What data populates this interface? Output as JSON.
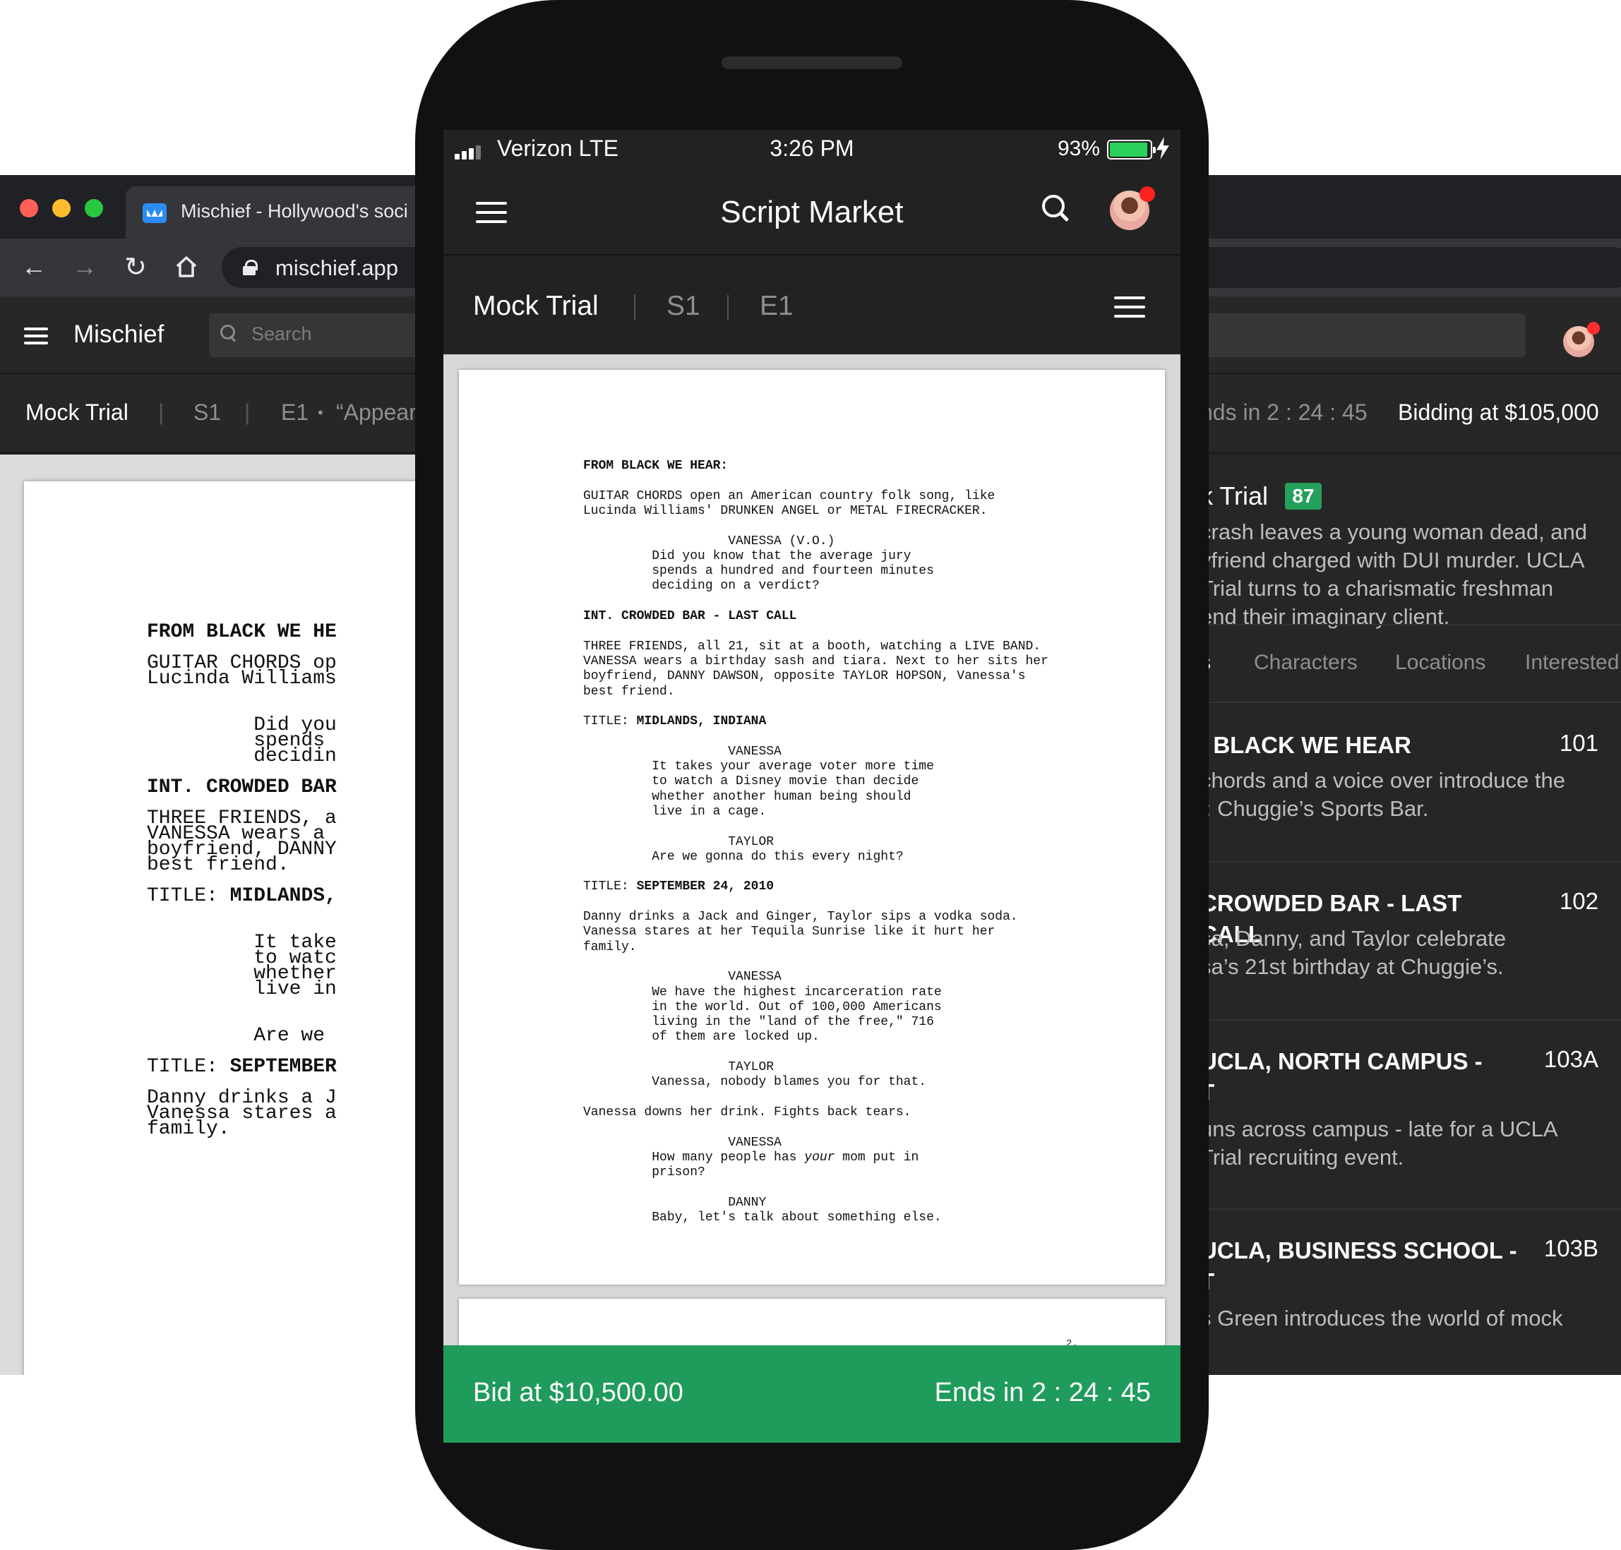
{
  "browser": {
    "tab_title": "Mischief - Hollywood's soci",
    "url": "mischief.app",
    "app_name": "Mischief",
    "search_placeholder": "Search",
    "breadcrumb": {
      "project": "Mock Trial",
      "sep1": "|",
      "season": "S1",
      "sep2": "|",
      "episode": "E1",
      "bullet": "•",
      "episode_title": "“Appear"
    },
    "ends_in": "nds in 2 : 24 : 45",
    "bidding": "Bidding at $105,000",
    "script_lines": [
      {
        "text": "FROM BLACK WE HE",
        "bold": true
      },
      {
        "text": "GUITAR CHORDS op"
      },
      {
        "text": "Lucinda Williams"
      },
      {
        "text": "         Did you"
      },
      {
        "text": "         spends"
      },
      {
        "text": "         decidin"
      },
      {
        "text": "INT. CROWDED BAR",
        "bold": true
      },
      {
        "text": "THREE FRIENDS, a"
      },
      {
        "text": "VANESSA wears a"
      },
      {
        "text": "boyfriend, DANNY"
      },
      {
        "text": "best friend."
      },
      {
        "text": "TITLE: MIDLANDS,"
      },
      {
        "text": "         It take"
      },
      {
        "text": "         to watc"
      },
      {
        "text": "         whether"
      },
      {
        "text": "         live in"
      },
      {
        "text": "         Are we"
      },
      {
        "text": "TITLE: SEPTEMBER"
      },
      {
        "text": "Danny drinks a J"
      },
      {
        "text": "Vanessa stares a"
      },
      {
        "text": "family."
      }
    ],
    "panel": {
      "title": "Trial",
      "title_prefix": "k",
      "score": "87",
      "description_lines": [
        "crash leaves a young woman dead, and",
        "yfriend charged with DUI murder. UCLA",
        " Trial turns to a charismatic freshman",
        "end their imaginary client."
      ],
      "tabs": [
        "s",
        "Characters",
        "Locations",
        "Interested"
      ],
      "scenes": [
        {
          "title": "I BLACK WE HEAR",
          "number": "101",
          "desc": [
            "chords and a voice over introduce the",
            "j: Chuggie’s Sports Bar."
          ]
        },
        {
          "title": "CROWDED BAR - LAST CALL",
          "number": "102",
          "desc": [
            "sa, Danny, and Taylor celebrate",
            "sa’s 21st birthday at Chuggie’s."
          ]
        },
        {
          "title": "UCLA, NORTH CAMPUS -",
          "title2": "T",
          "number": "103A",
          "desc": [
            "uns across campus - late for a UCLA",
            " Trial recruiting event."
          ]
        },
        {
          "title": "UCLA, BUSINESS SCHOOL -",
          "title2": "T",
          "number": "103B",
          "desc": [
            "s Green introduces the world of mock"
          ]
        }
      ]
    }
  },
  "phone": {
    "carrier": "Verizon LTE",
    "time": "3:26 PM",
    "battery": "93%",
    "battery_level": 0.93,
    "title": "Script Market",
    "breadcrumb": {
      "project": "Mock Trial",
      "season": "S1",
      "episode": "E1"
    },
    "page_number": "2.",
    "script": [
      {
        "text": "FROM BLACK WE HEAR:",
        "bold": true
      },
      {
        "text": ""
      },
      {
        "text": "GUITAR CHORDS open an American country folk song, like"
      },
      {
        "text": "Lucinda Williams' DRUNKEN ANGEL or METAL FIRECRACKER."
      },
      {
        "text": ""
      },
      {
        "text": "                   VANESSA (V.O.)"
      },
      {
        "text": "         Did you know that the average jury"
      },
      {
        "text": "         spends a hundred and fourteen minutes"
      },
      {
        "text": "         deciding on a verdict?"
      },
      {
        "text": ""
      },
      {
        "text": "INT. CROWDED BAR - LAST CALL",
        "bold": true
      },
      {
        "text": ""
      },
      {
        "text": "THREE FRIENDS, all 21, sit at a booth, watching a LIVE BAND."
      },
      {
        "text": "VANESSA wears a birthday sash and tiara. Next to her sits her"
      },
      {
        "text": "boyfriend, DANNY DAWSON, opposite TAYLOR HOPSON, Vanessa's"
      },
      {
        "text": "best friend."
      },
      {
        "text": ""
      },
      {
        "text": "TITLE: ",
        "boldtail": "MIDLANDS, INDIANA"
      },
      {
        "text": ""
      },
      {
        "text": "                   VANESSA"
      },
      {
        "text": "         It takes your average voter more time"
      },
      {
        "text": "         to watch a Disney movie than decide"
      },
      {
        "text": "         whether another human being should"
      },
      {
        "text": "         live in a cage."
      },
      {
        "text": ""
      },
      {
        "text": "                   TAYLOR"
      },
      {
        "text": "         Are we gonna do this every night?"
      },
      {
        "text": ""
      },
      {
        "text": "TITLE: ",
        "boldtail": "SEPTEMBER 24, 2010"
      },
      {
        "text": ""
      },
      {
        "text": "Danny drinks a Jack and Ginger, Taylor sips a vodka soda."
      },
      {
        "text": "Vanessa stares at her Tequila Sunrise like it hurt her"
      },
      {
        "text": "family."
      },
      {
        "text": ""
      },
      {
        "text": "                   VANESSA"
      },
      {
        "text": "         We have the highest incarceration rate"
      },
      {
        "text": "         in the world. Out of 100,000 Americans"
      },
      {
        "text": "         living in the \"land of the free,\" 716"
      },
      {
        "text": "         of them are locked up."
      },
      {
        "text": ""
      },
      {
        "text": "                   TAYLOR"
      },
      {
        "text": "         Vanessa, nobody blames you for that."
      },
      {
        "text": ""
      },
      {
        "text": "Vanessa downs her drink. Fights back tears."
      },
      {
        "text": ""
      },
      {
        "text": "                   VANESSA"
      },
      {
        "text": "         How many people has ",
        "italic": "your",
        "rest": " mom put in"
      },
      {
        "text": "         prison?"
      },
      {
        "text": ""
      },
      {
        "text": "                   DANNY"
      },
      {
        "text": "         Baby, let's talk about something else."
      }
    ],
    "bid_label": "Bid at $10,500.00",
    "ends_label": "Ends in 2 : 24 : 45"
  }
}
